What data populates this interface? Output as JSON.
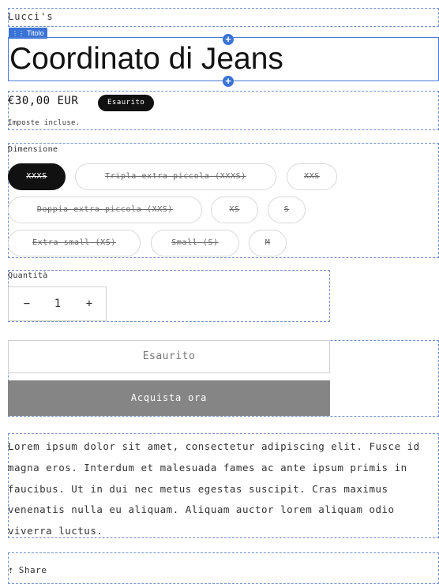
{
  "vendor": "Lucci's",
  "title_tag": {
    "icon": "title-field-icon",
    "label": "Titolo"
  },
  "product": {
    "title": "Coordinato di Jeans",
    "price": "€30,00 EUR",
    "badge": "Esaurito",
    "tax_note": "Imposte incluse."
  },
  "size": {
    "label": "Dimensione",
    "options": [
      {
        "label": "XXXS",
        "selected": true,
        "available": false
      },
      {
        "label": "Tripla extra piccola (XXXS)",
        "selected": false,
        "available": false
      },
      {
        "label": "XXS",
        "selected": false,
        "available": false
      },
      {
        "label": "Doppia extra piccola (XXS)",
        "selected": false,
        "available": false
      },
      {
        "label": "XS",
        "selected": false,
        "available": false
      },
      {
        "label": "S",
        "selected": false,
        "available": false
      },
      {
        "label": "Extra small (XS)",
        "selected": false,
        "available": false
      },
      {
        "label": "Small (S)",
        "selected": false,
        "available": false
      },
      {
        "label": "M",
        "selected": false,
        "available": false
      }
    ]
  },
  "quantity": {
    "label": "Quantità",
    "minus": "−",
    "value": "1",
    "plus": "+"
  },
  "buttons": {
    "sold_out": "Esaurito",
    "buy_now": "Acquista ora"
  },
  "description": "Lorem ipsum dolor sit amet, consectetur adipiscing elit. Fusce id magna eros. Interdum et malesuada fames ac ante ipsum primis in faucibus. Ut in dui nec metus egestas suscipit. Cras maximus venenatis nulla eu aliquam. Aliquam auctor lorem aliquam odio viverra luctus.",
  "share": {
    "icon": "share-icon",
    "label": "Share"
  },
  "colors": {
    "editor_accent": "#3a73d6",
    "buy_button": "#858585",
    "badge": "#111111"
  }
}
